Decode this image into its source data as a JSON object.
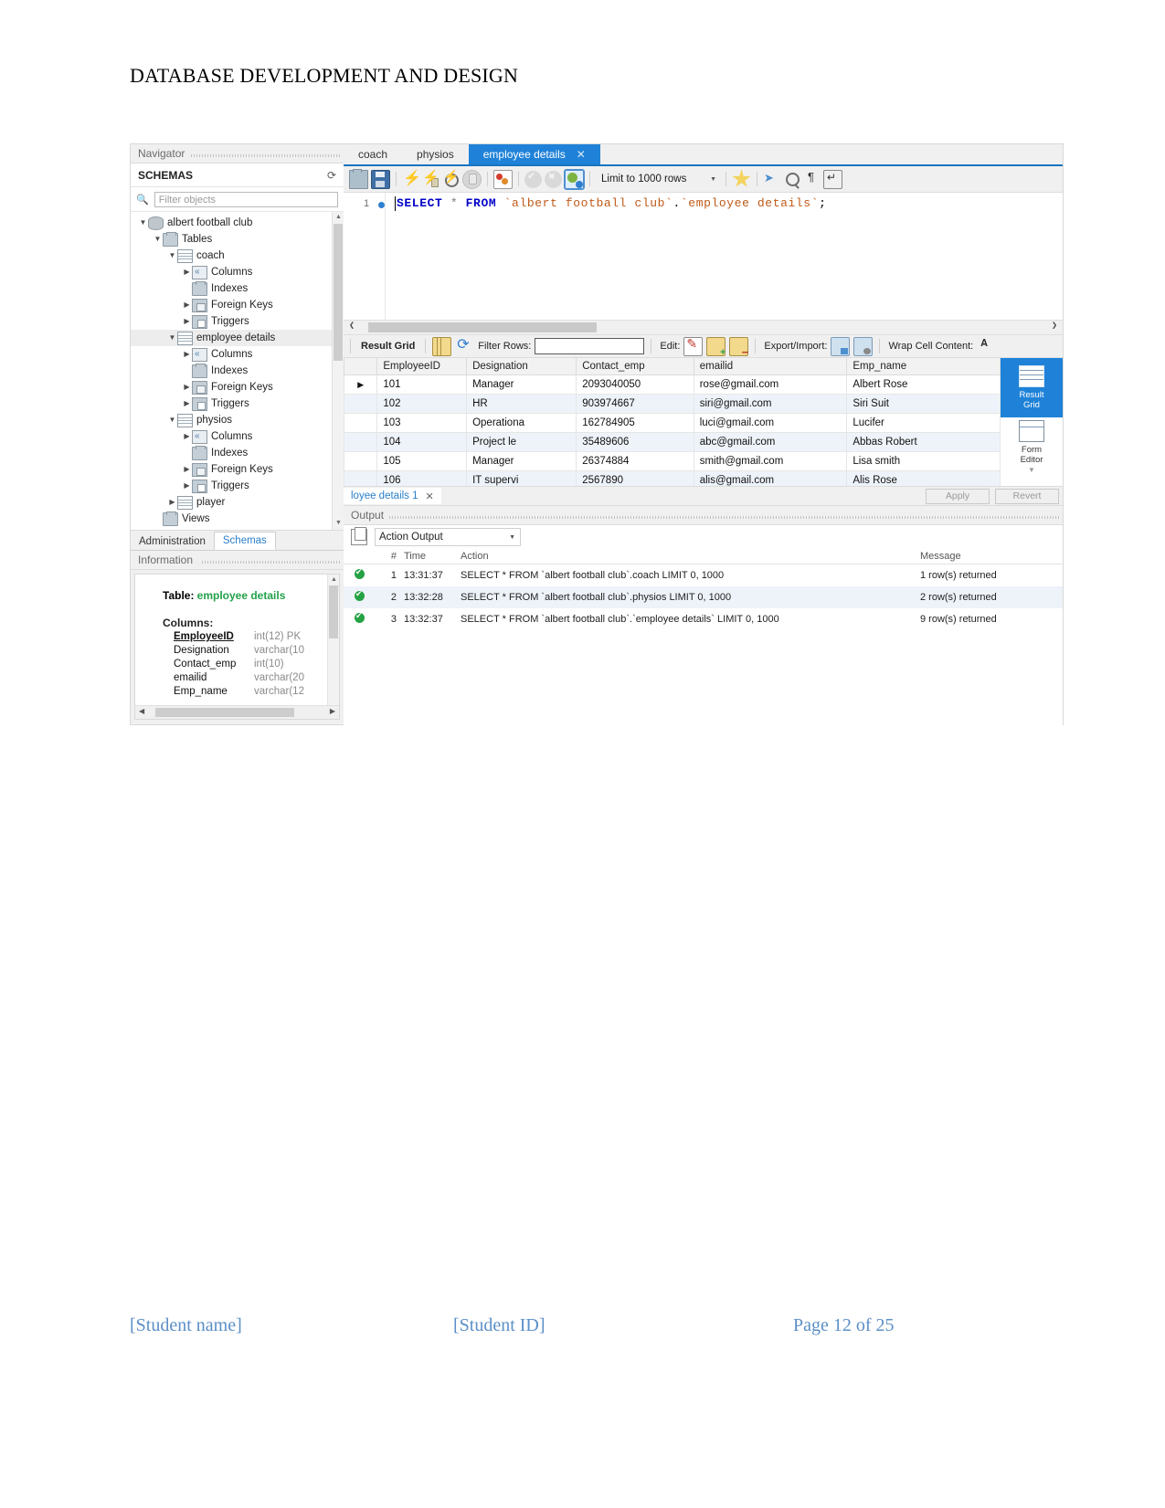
{
  "document": {
    "title": "DATABASE DEVELOPMENT AND DESIGN",
    "footer": {
      "student_name": "[Student name]",
      "student_id": "[Student ID]",
      "page": "Page 12 of 25"
    }
  },
  "navigator": {
    "panel_title": "Navigator",
    "schemas_label": "SCHEMAS",
    "refresh_icon": "refresh-icon",
    "filter": {
      "placeholder": "Filter objects",
      "value": ""
    },
    "tree": [
      {
        "label": "albert football club",
        "depth": 0,
        "icon": "database-icon",
        "state": "open"
      },
      {
        "label": "Tables",
        "depth": 1,
        "icon": "folder-icon",
        "state": "open"
      },
      {
        "label": "coach",
        "depth": 2,
        "icon": "table-icon",
        "state": "open"
      },
      {
        "label": "Columns",
        "depth": 3,
        "icon": "columns-icon",
        "state": "closed"
      },
      {
        "label": "Indexes",
        "depth": 3,
        "icon": "indexes-icon",
        "state": "none"
      },
      {
        "label": "Foreign Keys",
        "depth": 3,
        "icon": "foreign-keys-icon",
        "state": "closed"
      },
      {
        "label": "Triggers",
        "depth": 3,
        "icon": "triggers-icon",
        "state": "closed"
      },
      {
        "label": "employee details",
        "depth": 2,
        "icon": "table-icon",
        "state": "open",
        "selected": true
      },
      {
        "label": "Columns",
        "depth": 3,
        "icon": "columns-icon",
        "state": "closed"
      },
      {
        "label": "Indexes",
        "depth": 3,
        "icon": "indexes-icon",
        "state": "none"
      },
      {
        "label": "Foreign Keys",
        "depth": 3,
        "icon": "foreign-keys-icon",
        "state": "closed"
      },
      {
        "label": "Triggers",
        "depth": 3,
        "icon": "triggers-icon",
        "state": "closed"
      },
      {
        "label": "physios",
        "depth": 2,
        "icon": "table-icon",
        "state": "open"
      },
      {
        "label": "Columns",
        "depth": 3,
        "icon": "columns-icon",
        "state": "closed"
      },
      {
        "label": "Indexes",
        "depth": 3,
        "icon": "indexes-icon",
        "state": "none"
      },
      {
        "label": "Foreign Keys",
        "depth": 3,
        "icon": "foreign-keys-icon",
        "state": "closed"
      },
      {
        "label": "Triggers",
        "depth": 3,
        "icon": "triggers-icon",
        "state": "closed"
      },
      {
        "label": "player",
        "depth": 2,
        "icon": "table-icon",
        "state": "closed"
      },
      {
        "label": "Views",
        "depth": 1,
        "icon": "folder-icon",
        "state": "none"
      }
    ],
    "bottom_tabs": [
      {
        "label": "Administration",
        "active": false
      },
      {
        "label": "Schemas",
        "active": true
      }
    ]
  },
  "information": {
    "panel_title": "Information",
    "table_label": "Table:",
    "table_name": "employee details",
    "columns_label": "Columns:",
    "columns": [
      {
        "name": "EmployeeID",
        "type": "int(12) PK",
        "pk": true
      },
      {
        "name": "Designation",
        "type": "varchar(10",
        "pk": false
      },
      {
        "name": "Contact_emp",
        "type": "int(10)",
        "pk": false
      },
      {
        "name": "emailid",
        "type": "varchar(20",
        "pk": false
      },
      {
        "name": "Emp_name",
        "type": "varchar(12",
        "pk": false
      }
    ]
  },
  "editor": {
    "tabs": [
      {
        "label": "coach",
        "active": false,
        "closable": false
      },
      {
        "label": "physios",
        "active": false,
        "closable": false
      },
      {
        "label": "employee details",
        "active": true,
        "closable": true,
        "close_icon": "close-icon"
      }
    ],
    "toolbar": {
      "icons": [
        "open-script-icon",
        "save-script-icon",
        "execute-icon",
        "execute-current-statement-icon",
        "explain-icon",
        "stop-icon",
        "toggle-breakpoint-icon",
        "commit-icon",
        "rollback-icon",
        "autocommit-icon"
      ],
      "limit_label": "Limit to 1000 rows",
      "limit_caret": "chevron-down-icon",
      "right_icons": [
        "beautify-icon",
        "find-icon",
        "search-icon",
        "invisible-chars-icon",
        "wrap-lines-icon"
      ]
    },
    "line_number": "1",
    "sql": {
      "full": "SELECT * FROM `albert football club`.`employee details`;",
      "kw_select": "SELECT",
      "star": "*",
      "kw_from": "FROM",
      "schema": "`albert football club`",
      "dot": ".",
      "table": "`employee details`",
      "terminator": ";"
    }
  },
  "result_grid": {
    "toolbar": {
      "title": "Result Grid",
      "grid_icon": "grid-icon",
      "refresh_icon": "refresh-icon",
      "filter_rows_label": "Filter Rows:",
      "filter_rows_value": "",
      "edit_label": "Edit:",
      "edit_icons": [
        "edit-row-icon",
        "insert-row-icon",
        "delete-row-icon"
      ],
      "export_label": "Export/Import:",
      "export_icons": [
        "export-recordset-icon",
        "import-recordset-icon"
      ],
      "wrap_label": "Wrap Cell Content:",
      "wrap_icon": "wrap-cell-icon"
    },
    "columns": [
      "EmployeeID",
      "Designation",
      "Contact_emp",
      "emailid",
      "Emp_name"
    ],
    "rows": [
      {
        "marker": "▶",
        "EmployeeID": "101",
        "Designation": "Manager",
        "Contact_emp": "2093040050",
        "emailid": "rose@gmail.com",
        "Emp_name": "Albert Rose"
      },
      {
        "marker": "",
        "EmployeeID": "102",
        "Designation": "HR",
        "Contact_emp": "903974667",
        "emailid": "siri@gmail.com",
        "Emp_name": "Siri Suit"
      },
      {
        "marker": "",
        "EmployeeID": "103",
        "Designation": "Operationa",
        "Contact_emp": "162784905",
        "emailid": "luci@gmail.com",
        "Emp_name": "Lucifer"
      },
      {
        "marker": "",
        "EmployeeID": "104",
        "Designation": "Project le",
        "Contact_emp": "35489606",
        "emailid": "abc@gmail.com",
        "Emp_name": "Abbas Robert"
      },
      {
        "marker": "",
        "EmployeeID": "105",
        "Designation": "Manager",
        "Contact_emp": "26374884",
        "emailid": "smith@gmail.com",
        "Emp_name": "Lisa smith"
      },
      {
        "marker": "",
        "EmployeeID": "106",
        "Designation": "IT supervi",
        "Contact_emp": "2567890",
        "emailid": "alis@gmail.com",
        "Emp_name": "Alis Rose"
      }
    ],
    "side_buttons": [
      {
        "label": "Result\nGrid",
        "line1": "Result",
        "line2": "Grid",
        "active": true,
        "icon": "result-grid-icon"
      },
      {
        "label": "Form\nEditor",
        "line1": "Form",
        "line2": "Editor",
        "active": false,
        "icon": "form-editor-icon"
      }
    ],
    "result_tab": {
      "label": "loyee details 1",
      "close_icon": "close-icon"
    },
    "apply_label": "Apply",
    "revert_label": "Revert"
  },
  "output": {
    "panel_title": "Output",
    "copy_icon": "copy-icon",
    "mode": "Action Output",
    "mode_caret": "chevron-down-icon",
    "columns": [
      "#",
      "Time",
      "Action",
      "Message"
    ],
    "rows": [
      {
        "status": "success",
        "no": "1",
        "time": "13:31:37",
        "action": "SELECT * FROM `albert football club`.coach LIMIT 0, 1000",
        "message": "1 row(s) returned"
      },
      {
        "status": "success",
        "no": "2",
        "time": "13:32:28",
        "action": "SELECT * FROM `albert football club`.physios LIMIT 0, 1000",
        "message": "2 row(s) returned"
      },
      {
        "status": "success",
        "no": "3",
        "time": "13:32:37",
        "action": "SELECT * FROM `albert football club`.`employee details` LIMIT 0, 1000",
        "message": "9 row(s) returned"
      }
    ]
  },
  "colors": {
    "accent_blue": "#1f82d8",
    "tab_active": "#1f82d8",
    "link_blue": "#2a7fc9",
    "success_green": "#25a244",
    "schema_green": "#22a24a",
    "footer_blue": "#5b8fc7"
  }
}
